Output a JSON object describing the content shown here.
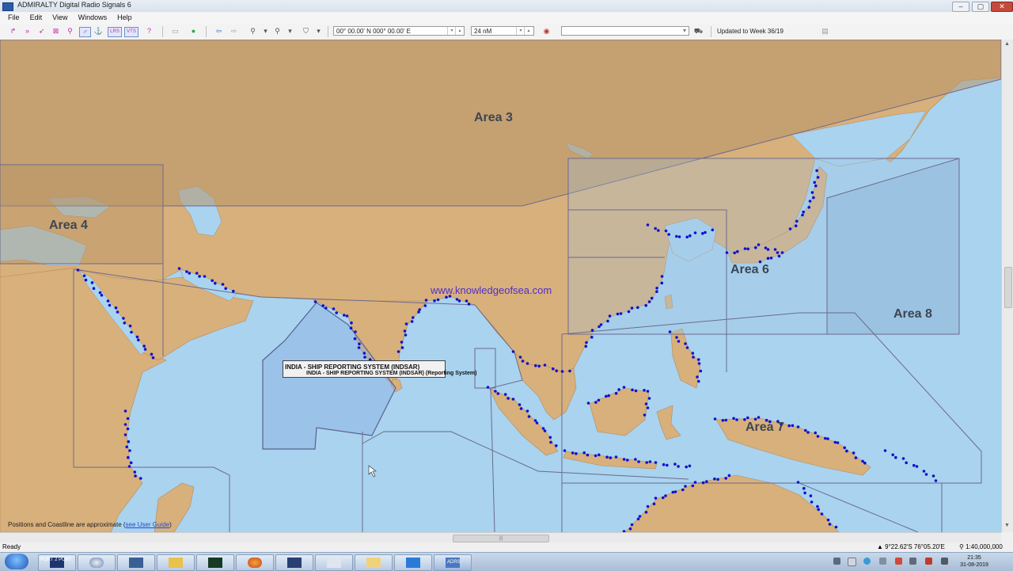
{
  "window": {
    "title": "ADMIRALTY Digital Radio Signals 6",
    "controls": {
      "minimize": "–",
      "maximize": "▢",
      "close": "✕"
    }
  },
  "menu": {
    "items": [
      "File",
      "Edit",
      "View",
      "Windows",
      "Help"
    ]
  },
  "toolbar": {
    "coordinate_value": "00° 00.00' N 000° 00.00' E",
    "range_value": "24 nM",
    "search_value": "",
    "update_text": "Updated to Week 36/19",
    "lrs_label": "LRS",
    "vts_label": "VTS",
    "help_symbol": "?"
  },
  "map": {
    "area_labels": [
      "Area 3",
      "Area 4",
      "Area 6",
      "Area 8",
      "Area 7"
    ],
    "website": "www.knowledgeofsea.com",
    "tooltip_title": "INDIA - SHIP REPORTING SYSTEM (INDSAR)",
    "tooltip_subtitle": "INDIA - SHIP REPORTING SYSTEM (INDSAR) (Reporting System)",
    "note_text": "Positions and Coastline are approximate (",
    "note_link": "see User Guide",
    "note_end": ")",
    "colors": {
      "sea": "#a9d3ef",
      "land": "#d8b07c",
      "area_fill": "#b79467",
      "station": "#1010cc",
      "boundary": "#6d6a8c"
    }
  },
  "status": {
    "ready": "Ready",
    "coordinates": "9°22.62'S 76°05.20'E",
    "scale": "1:40,000,000"
  },
  "taskbar": {
    "apps": [
      {
        "label": "PORT 2 PORT",
        "icon": "port2port-icon"
      },
      {
        "label": "",
        "icon": "globe-icon"
      },
      {
        "label": "",
        "icon": "computer-icon"
      },
      {
        "label": "",
        "icon": "mail-icon"
      },
      {
        "label": "",
        "icon": "terminal-icon"
      },
      {
        "label": "",
        "icon": "firefox-icon"
      },
      {
        "label": "",
        "icon": "window-icon"
      },
      {
        "label": "",
        "icon": "document-icon"
      },
      {
        "label": "",
        "icon": "folder-icon"
      },
      {
        "label": "",
        "icon": "video-icon"
      },
      {
        "label": "ADRS",
        "icon": "adrs-icon"
      }
    ],
    "clock_time": "21:35",
    "clock_date": "31-08-2019"
  }
}
